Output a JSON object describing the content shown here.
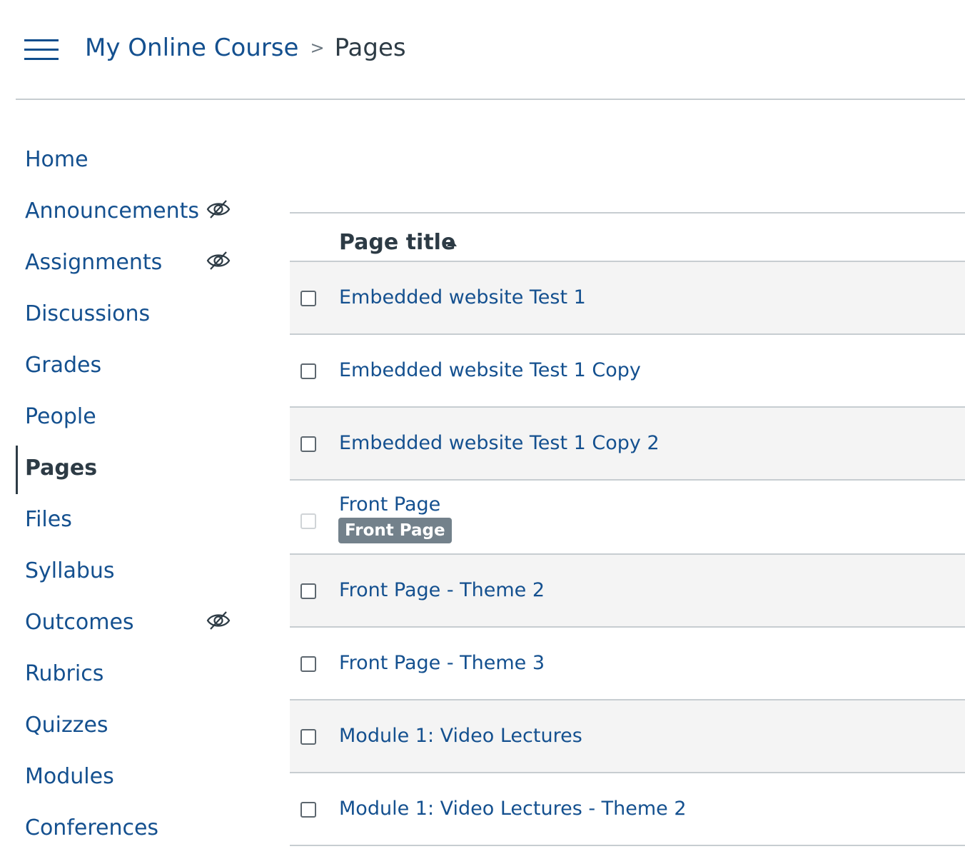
{
  "header": {
    "menu_icon": "hamburger-icon",
    "breadcrumb": {
      "course": "My Online Course",
      "separator": ">",
      "current": "Pages"
    }
  },
  "sidebar": {
    "items": [
      {
        "label": "Home",
        "hidden_from_students": false,
        "active": false
      },
      {
        "label": "Announcements",
        "hidden_from_students": true,
        "active": false
      },
      {
        "label": "Assignments",
        "hidden_from_students": true,
        "active": false
      },
      {
        "label": "Discussions",
        "hidden_from_students": false,
        "active": false
      },
      {
        "label": "Grades",
        "hidden_from_students": false,
        "active": false
      },
      {
        "label": "People",
        "hidden_from_students": false,
        "active": false
      },
      {
        "label": "Pages",
        "hidden_from_students": false,
        "active": true
      },
      {
        "label": "Files",
        "hidden_from_students": false,
        "active": false
      },
      {
        "label": "Syllabus",
        "hidden_from_students": false,
        "active": false
      },
      {
        "label": "Outcomes",
        "hidden_from_students": true,
        "active": false
      },
      {
        "label": "Rubrics",
        "hidden_from_students": false,
        "active": false
      },
      {
        "label": "Quizzes",
        "hidden_from_students": false,
        "active": false
      },
      {
        "label": "Modules",
        "hidden_from_students": false,
        "active": false
      },
      {
        "label": "Conferences",
        "hidden_from_students": false,
        "active": false
      }
    ],
    "hidden_icon": "eye-slash-icon"
  },
  "table": {
    "column_header": "Page title",
    "sort_direction": "ascending",
    "rows": [
      {
        "title": "Embedded website Test 1",
        "badge": "",
        "checkbox_disabled": false
      },
      {
        "title": "Embedded website Test 1 Copy",
        "badge": "",
        "checkbox_disabled": false
      },
      {
        "title": "Embedded website Test 1 Copy 2",
        "badge": "",
        "checkbox_disabled": false
      },
      {
        "title": "Front Page",
        "badge": "Front Page",
        "checkbox_disabled": true
      },
      {
        "title": "Front Page - Theme 2",
        "badge": "",
        "checkbox_disabled": false
      },
      {
        "title": "Front Page - Theme 3",
        "badge": "",
        "checkbox_disabled": false
      },
      {
        "title": "Module 1: Video Lectures",
        "badge": "",
        "checkbox_disabled": false
      },
      {
        "title": "Module 1: Video Lectures - Theme 2",
        "badge": "",
        "checkbox_disabled": false
      }
    ]
  },
  "colors": {
    "link": "#14508f",
    "text": "#2d3b45",
    "row_alt": "#f4f4f4",
    "badge": "#73818b"
  }
}
